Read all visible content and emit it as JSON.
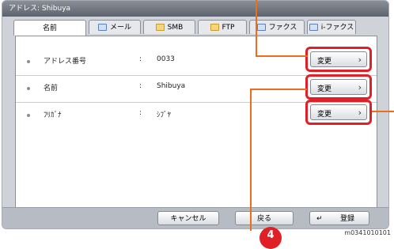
{
  "window": {
    "title": "アドレス: Shibuya"
  },
  "tabs": [
    {
      "label": "名前",
      "icon": ""
    },
    {
      "label": "メール",
      "icon": "mail-icon"
    },
    {
      "label": "SMB",
      "icon": "folder-icon"
    },
    {
      "label": "FTP",
      "icon": "folder-icon"
    },
    {
      "label": "ファクス",
      "icon": "fax-icon"
    },
    {
      "label": "i-ファクス",
      "icon": "ifax-icon"
    }
  ],
  "rows": [
    {
      "label": "アドレス番号",
      "colon": ":",
      "value": "0033",
      "button": "変更",
      "arrow": "›"
    },
    {
      "label": "名前",
      "colon": ":",
      "value": "Shibuya",
      "button": "変更",
      "arrow": "›"
    },
    {
      "label": "ﾌﾘｶﾞﾅ",
      "colon": ":",
      "value": "ｼﾌﾞﾔ",
      "button": "変更",
      "arrow": "›"
    }
  ],
  "footer": {
    "cancel": "キャンセル",
    "back": "戻る",
    "register_icon": "↵",
    "register": "登録"
  },
  "callout": {
    "number": "4"
  },
  "figure_id": "m0341010101",
  "colors": {
    "highlight": "#e01f26",
    "callout": "#ef6c1a"
  }
}
